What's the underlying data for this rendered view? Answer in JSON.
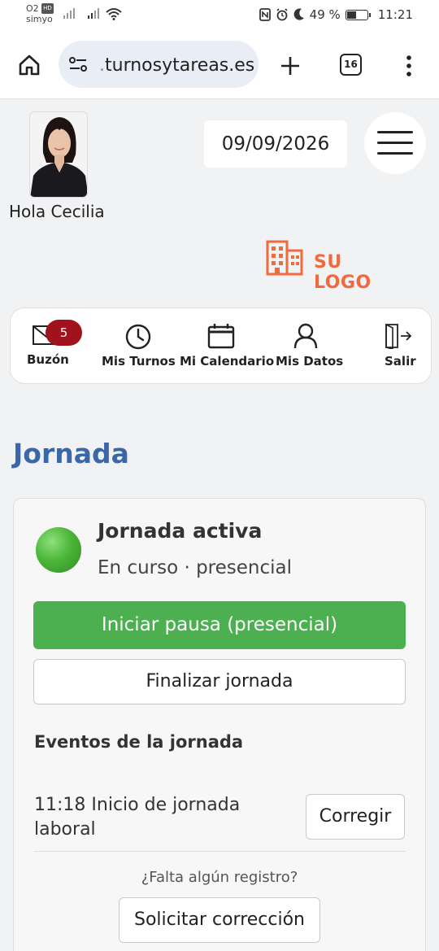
{
  "status_bar": {
    "carrier_badge": "O2",
    "carrier_hd": "HD",
    "carrier_name": "simyo",
    "battery_percent": "49 %",
    "time": "11:21"
  },
  "browser": {
    "url_prefix": ".",
    "url_domain": "turnosytareas.es",
    "tab_count": "16"
  },
  "header": {
    "greeting": "Hola Cecilia",
    "date": "09/09/2026",
    "logo_text": "SU LOGO"
  },
  "nav": {
    "items": [
      {
        "label": "Buzón",
        "icon": "mail-icon",
        "badge": "5"
      },
      {
        "label": "Mis Turnos",
        "icon": "clock-icon"
      },
      {
        "label": "Mi Calendario",
        "icon": "calendar-icon"
      },
      {
        "label": "Mis Datos",
        "icon": "user-icon"
      },
      {
        "label": "Salir",
        "icon": "logout-icon"
      }
    ]
  },
  "section": {
    "title": "Jornada"
  },
  "jornada": {
    "status_color": "#4cb63a",
    "title": "Jornada activa",
    "subtitle": "En curso · presencial",
    "primary_button": "Iniciar pausa (presencial)",
    "secondary_button": "Finalizar jornada",
    "events_title": "Eventos de la jornada",
    "events": [
      {
        "text": "11:18 Inicio de jornada laboral",
        "action": "Corregir"
      }
    ],
    "missing_text": "¿Falta algún registro?",
    "request_button": "Solicitar corrección"
  },
  "colors": {
    "accent_blue": "#3a67a8",
    "green": "#4caf50",
    "badge_red": "#a0121c",
    "logo_orange": "#f06a3e"
  }
}
